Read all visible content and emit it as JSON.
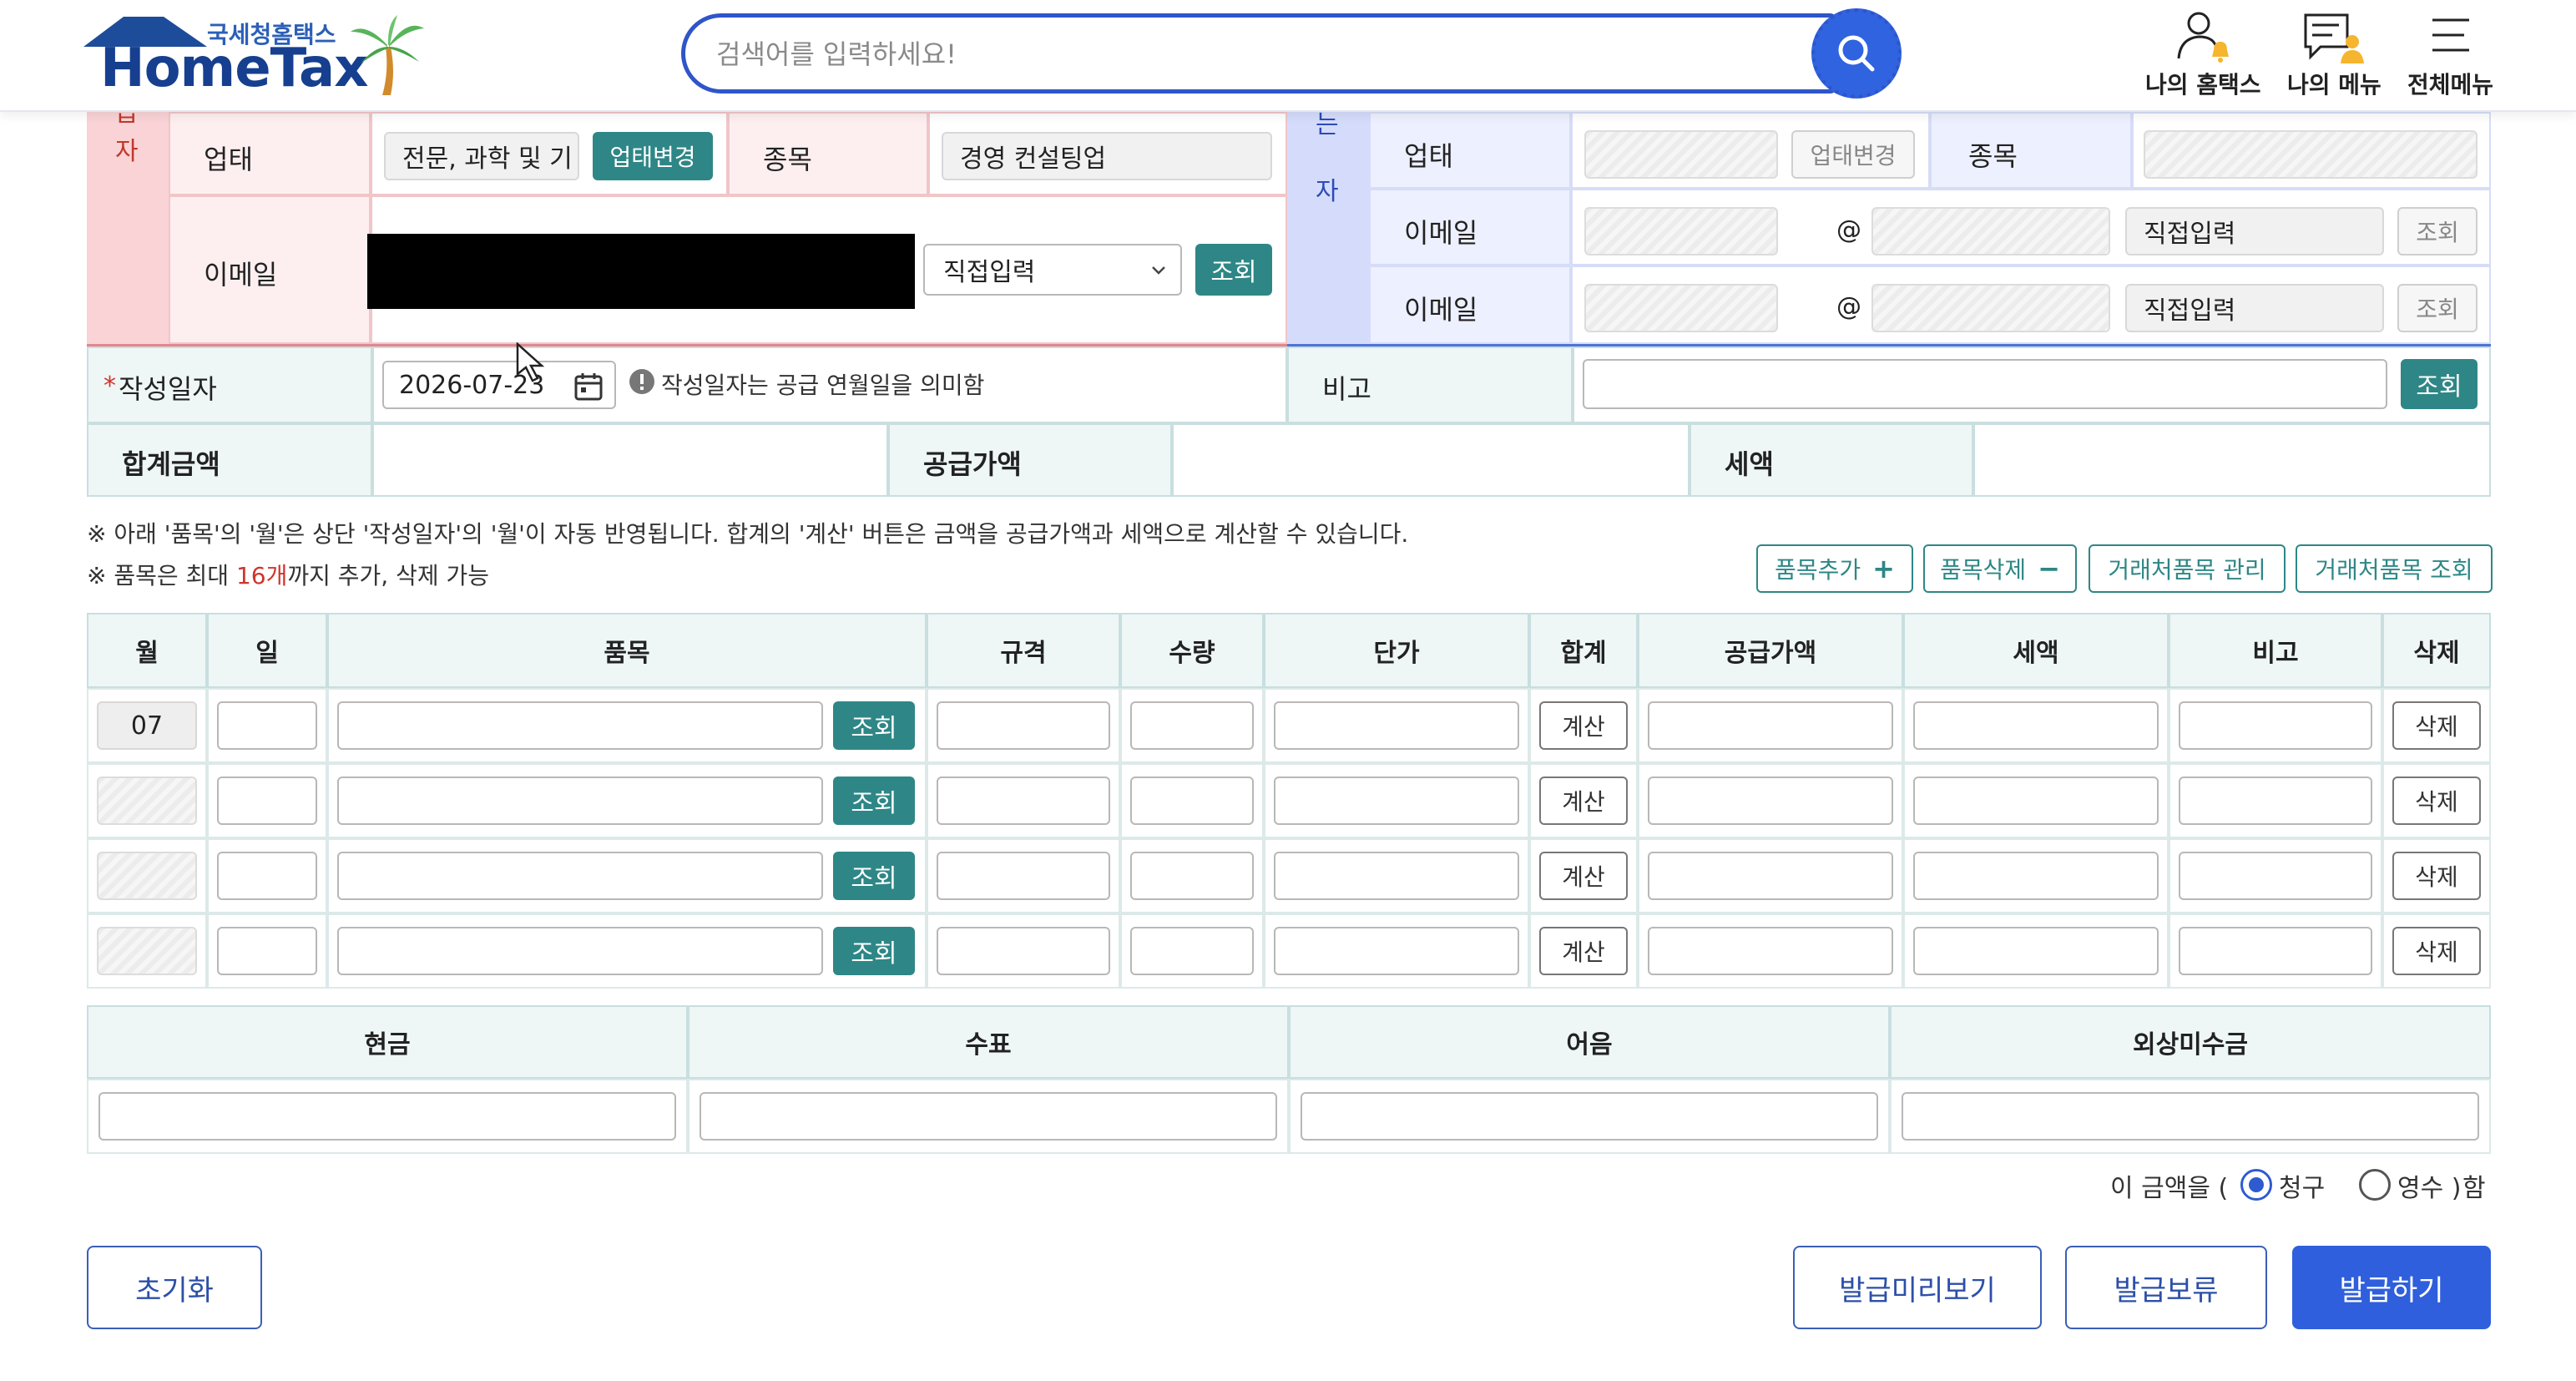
{
  "header": {
    "logo_sub": "국세청홈택스",
    "logo_main": "HomeTax",
    "search_placeholder": "검색어를 입력하세요!",
    "nav": [
      "나의 홈택스",
      "나의 메뉴",
      "전체메뉴"
    ]
  },
  "supplier": {
    "side_label_top": "급",
    "side_label_bottom": "자",
    "business_type_label": "업태",
    "business_type_value": "전문, 과학 및 기",
    "business_type_change": "업태변경",
    "item_label": "종목",
    "item_value": "경영 컨설팅업",
    "email_label": "이메일",
    "email_domain_select": "직접입력",
    "lookup": "조회"
  },
  "recipient": {
    "side_label": "는\n자",
    "side_label_top": "는",
    "side_label_bottom": "자",
    "business_type_label": "업태",
    "business_type_change": "업태변경",
    "item_label": "종목",
    "email_label": "이메일",
    "at": "@",
    "email_domain_select": "직접입력",
    "lookup": "조회"
  },
  "date_row": {
    "star": "*",
    "label": "작성일자",
    "value": "2026-07-23",
    "hint": "작성일자는 공급 연월일을 의미함",
    "remark_label": "비고",
    "lookup": "조회"
  },
  "totals_row": {
    "total_label": "합계금액",
    "supply_label": "공급가액",
    "tax_label": "세액"
  },
  "notes": {
    "line1": "※ 아래 '품목'의 '월'은 상단 '작성일자'의 '월'이 자동 반영됩니다. 합계의 '계산' 버튼은 금액을 공급가액과 세액으로 계산할 수 있습니다.",
    "line2_prefix": "※ 품목은 최대 ",
    "line2_highlight": "16개",
    "line2_suffix": "까지 추가, 삭제 가능"
  },
  "item_actions": {
    "add": "품목추가",
    "add_symbol": "+",
    "remove": "품목삭제",
    "remove_symbol": "−",
    "manage": "거래처품목 관리",
    "lookup": "거래처품목 조회"
  },
  "items_table": {
    "headers": [
      "월",
      "일",
      "품목",
      "규격",
      "수량",
      "단가",
      "합계",
      "공급가액",
      "세액",
      "비고",
      "삭제"
    ],
    "first_month": "07",
    "lookup": "조회",
    "calc": "계산",
    "delete": "삭제"
  },
  "payment_table": {
    "headers": [
      "현금",
      "수표",
      "어음",
      "외상미수금"
    ]
  },
  "receipt": {
    "prefix": "이 금액을 (",
    "option_claim": "청구",
    "option_receipt": "영수 )",
    "suffix": "함",
    "selected": "청구"
  },
  "footer": {
    "reset": "초기화",
    "preview": "발급미리보기",
    "hold": "발급보류",
    "issue": "발급하기"
  }
}
